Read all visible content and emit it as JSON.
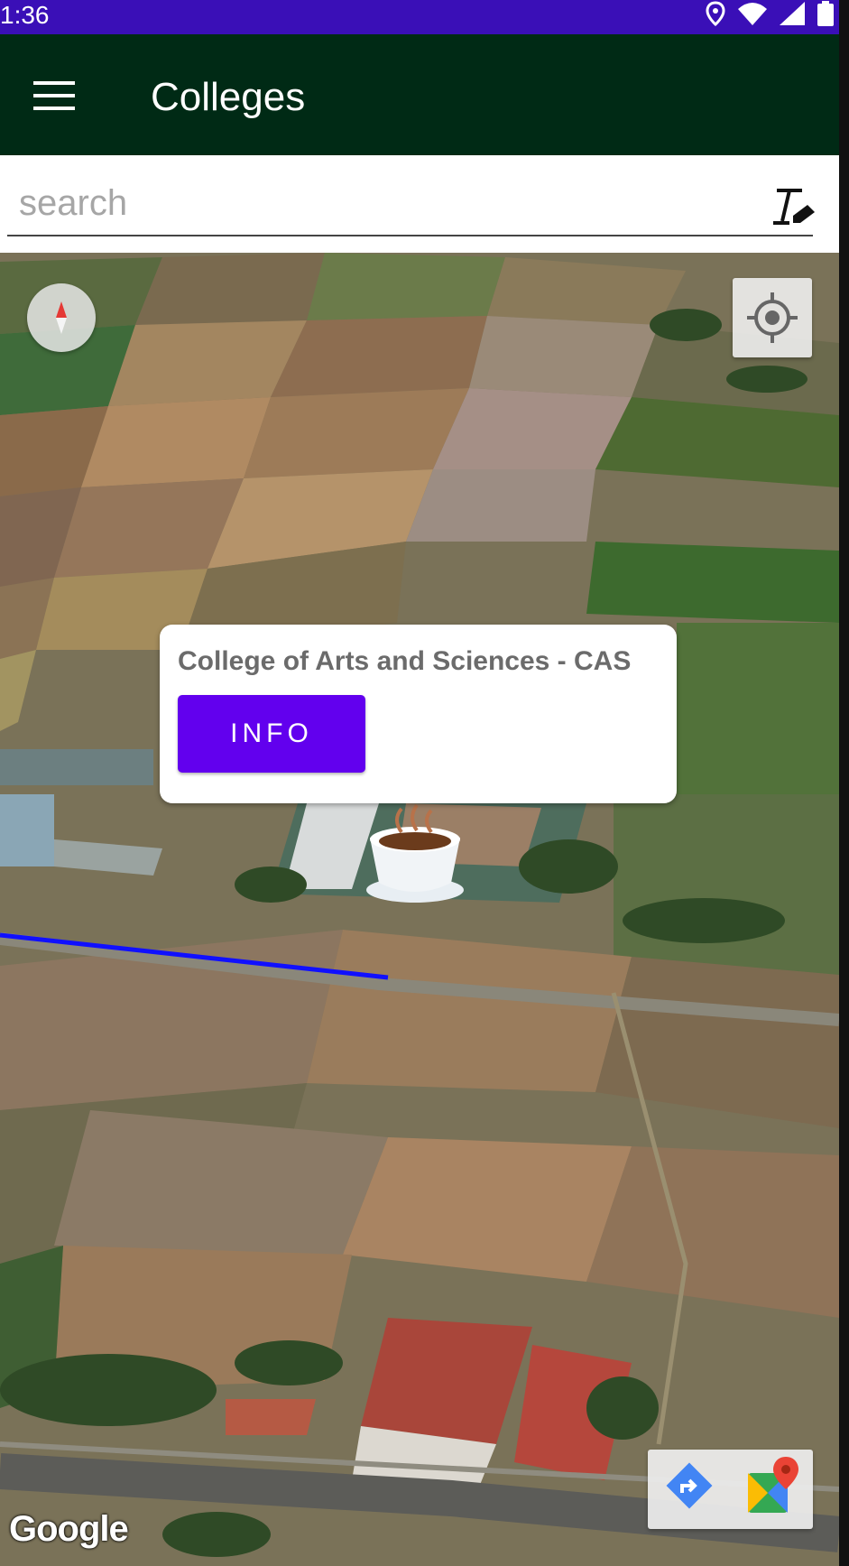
{
  "status_bar": {
    "time": "1:36"
  },
  "app_bar": {
    "title": "Colleges"
  },
  "search": {
    "placeholder": "search",
    "value": ""
  },
  "map": {
    "type": "satellite",
    "marker_icon": "coffee-cup-icon",
    "info_window": {
      "title": "College of Arts and Sciences - CAS",
      "button_label": "INFO"
    },
    "attribution": "Google"
  },
  "colors": {
    "status_bar": "#3a0fb7",
    "app_bar": "#002a15",
    "accent": "#6200ee",
    "route_line": "#1010ff"
  }
}
